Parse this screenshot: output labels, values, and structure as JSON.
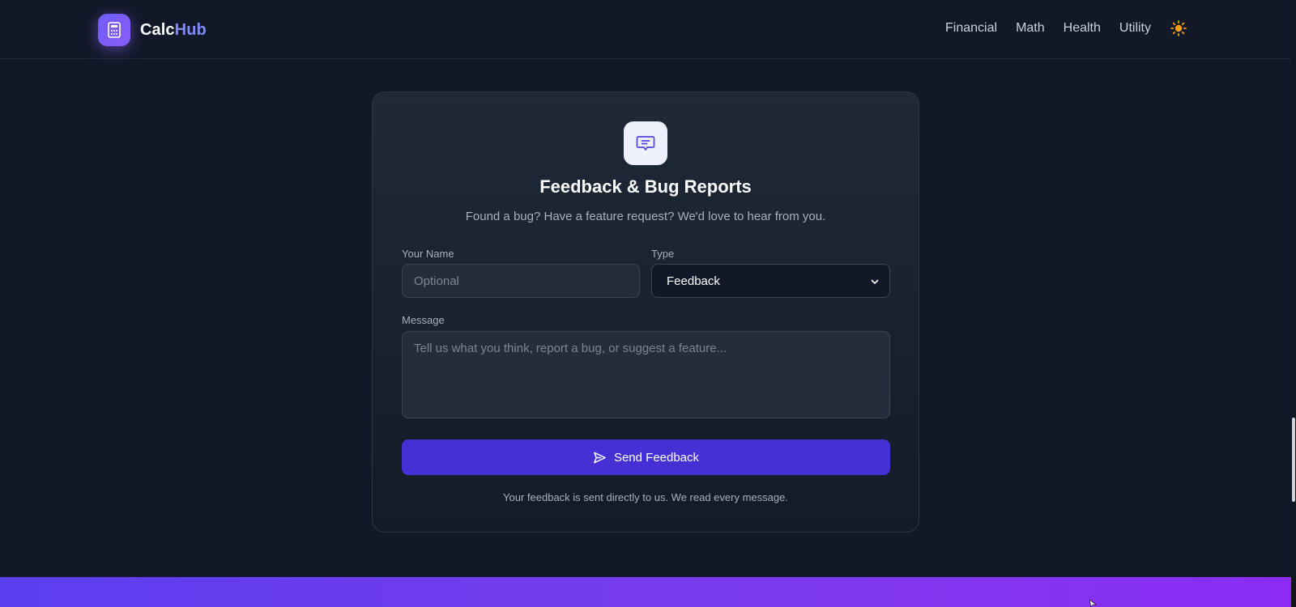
{
  "header": {
    "brand_part1": "Calc",
    "brand_part2": "Hub",
    "nav": [
      "Financial",
      "Math",
      "Health",
      "Utility"
    ],
    "theme_icon": "sun-icon",
    "logo_icon": "calculator-icon"
  },
  "feedback": {
    "icon": "message-icon",
    "title": "Feedback & Bug Reports",
    "subtitle": "Found a bug? Have a feature request? We'd love to hear from you.",
    "name_label": "Your Name",
    "name_placeholder": "Optional",
    "type_label": "Type",
    "type_value": "Feedback",
    "message_label": "Message",
    "message_placeholder": "Tell us what you think, report a bug, or suggest a feature...",
    "send_label": "Send Feedback",
    "footnote": "Your feedback is sent directly to us. We read every message."
  },
  "colors": {
    "background": "#111827",
    "accent": "#4530d6",
    "brand_highlight": "#818cf8",
    "sun": "#f59e0b"
  }
}
